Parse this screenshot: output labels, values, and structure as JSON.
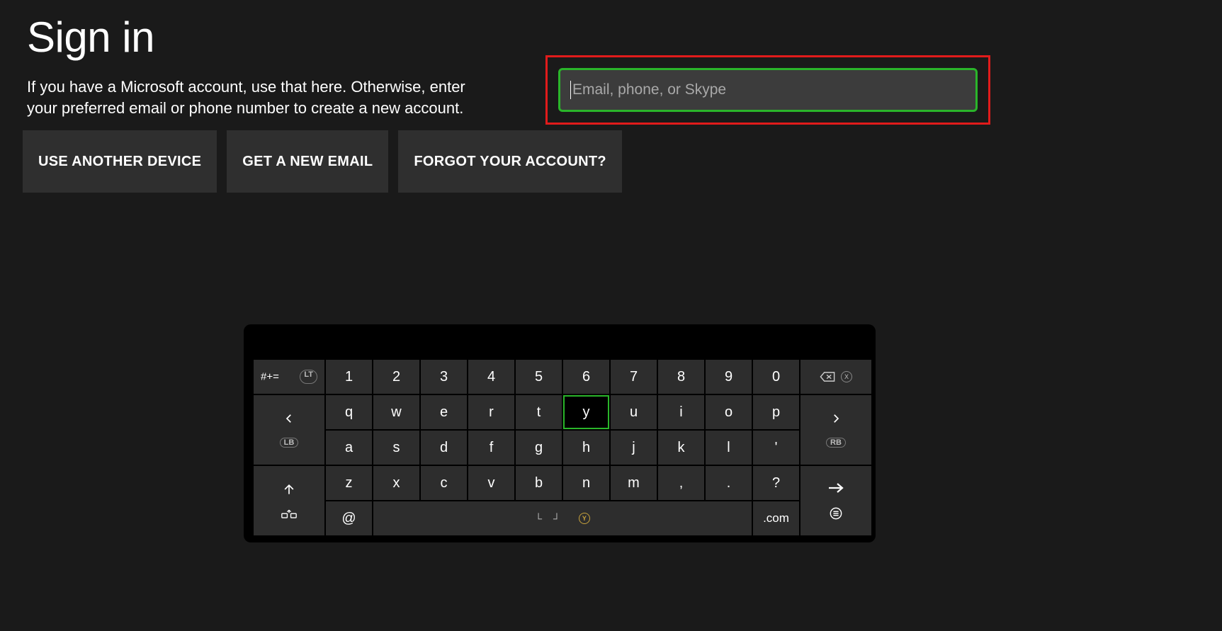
{
  "page": {
    "title": "Sign in",
    "description": "If you have a Microsoft account, use that here. Otherwise, enter your preferred email or phone number to create a new account."
  },
  "buttons": {
    "use_another_device": "USE ANOTHER DEVICE",
    "get_new_email": "GET A NEW EMAIL",
    "forgot_account": "FORGOT YOUR ACCOUNT?"
  },
  "input": {
    "placeholder": "Email, phone, or Skype",
    "value": ""
  },
  "keyboard": {
    "symbols_label": "#+=",
    "symbols_badge": "LT",
    "row_num": [
      "1",
      "2",
      "3",
      "4",
      "5",
      "6",
      "7",
      "8",
      "9",
      "0"
    ],
    "row_top": [
      "q",
      "w",
      "e",
      "r",
      "t",
      "y",
      "u",
      "i",
      "o",
      "p"
    ],
    "row_mid": [
      "a",
      "s",
      "d",
      "f",
      "g",
      "h",
      "j",
      "k",
      "l",
      "'"
    ],
    "row_bot": [
      "z",
      "x",
      "c",
      "v",
      "b",
      "n",
      "m",
      ",",
      ".",
      "?"
    ],
    "key_at": "@",
    "key_com": ".com",
    "badge_lb": "LB",
    "badge_rb": "RB",
    "badge_x": "X",
    "badge_y": "Y",
    "selected_key": "y"
  }
}
